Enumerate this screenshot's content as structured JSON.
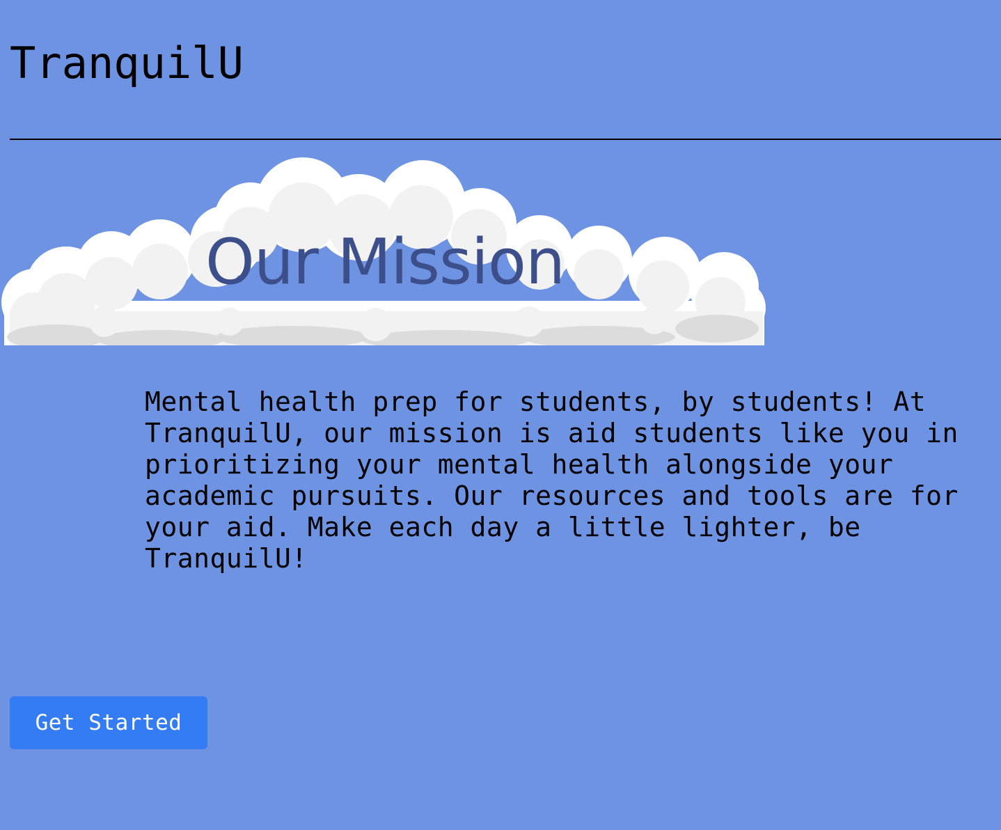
{
  "header": {
    "site_title": "TranquilU"
  },
  "mission": {
    "heading": "Our Mission",
    "body": "Mental health prep for students, by students! At TranquilU, our mission is aid students like you in prioritizing your mental health alongside your academic pursuits. Our resources and tools are for your aid. Make each day a little lighter, be TranquilU!"
  },
  "cta": {
    "button_label": "Get Started"
  },
  "colors": {
    "page_background": "#6f93e3",
    "heading_text": "#3d4f8a",
    "button_background": "#347cf4",
    "button_text": "#ffffff",
    "cloud_fill": "#f4f4f4",
    "cloud_shadow": "#dcdcdc"
  },
  "icons": {
    "banner_image": "cloud-image"
  }
}
